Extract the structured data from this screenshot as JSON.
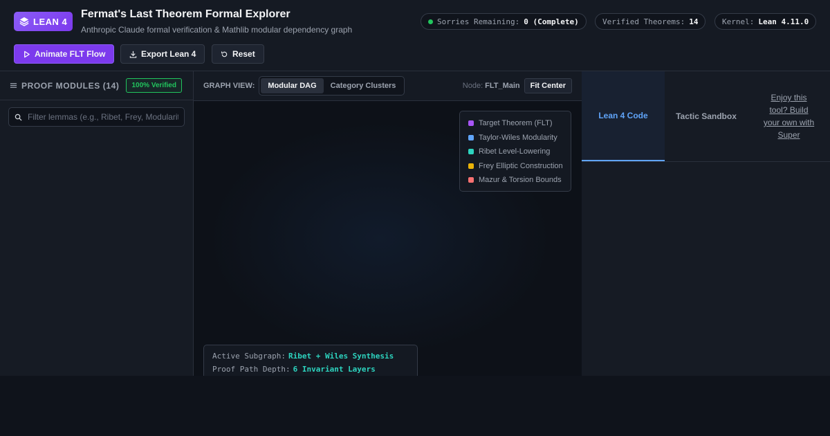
{
  "header": {
    "logo_text": "LEAN 4",
    "title": "Fermat's Last Theorem Formal Explorer",
    "subtitle": "Anthropic Claude formal verification & Mathlib modular dependency graph",
    "stats": [
      {
        "label": "Sorries Remaining:",
        "value": "0 (Complete)"
      },
      {
        "label": "Verified Theorems:",
        "value": "14"
      },
      {
        "label": "Kernel:",
        "value": "Lean 4.11.0"
      }
    ],
    "status_color": "#22c55e"
  },
  "toolbar": {
    "animate_label": "Animate FLT Flow",
    "export_label": "Export Lean 4",
    "reset_label": "Reset"
  },
  "sidebar": {
    "title": "PROOF MODULES (14)",
    "badge": "100% Verified",
    "search_placeholder": "Filter lemmas (e.g., Ribet, Frey, Modularity)"
  },
  "graph": {
    "view_label": "GRAPH VIEW:",
    "views": [
      "Modular DAG",
      "Category Clusters"
    ],
    "active_view": "Modular DAG",
    "node_label": "Node:",
    "node_value": "FLT_Main",
    "fit_label": "Fit Center",
    "legend": [
      {
        "label": "Target Theorem (FLT)",
        "color": "#a855f7"
      },
      {
        "label": "Taylor-Wiles Modularity",
        "color": "#60a5fa"
      },
      {
        "label": "Ribet Level-Lowering",
        "color": "#2dd4bf"
      },
      {
        "label": "Frey Elliptic Construction",
        "color": "#eab308"
      },
      {
        "label": "Mazur & Torsion Bounds",
        "color": "#f87171"
      }
    ],
    "subgraph_label": "Active Subgraph:",
    "subgraph_value": "Ribet + Wiles Synthesis",
    "depth_label": "Proof Path Depth:",
    "depth_value": "6 Invariant Layers"
  },
  "right_panel": {
    "tabs": [
      "Lean 4 Code",
      "Tactic Sandbox"
    ],
    "active_tab": "Lean 4 Code",
    "promo": "Enjoy this tool? Build your own with Super"
  },
  "accent_colors": {
    "primary": "#7c3aed",
    "tab_active": "#60a5fa",
    "highlight": "#2dd4bf"
  }
}
